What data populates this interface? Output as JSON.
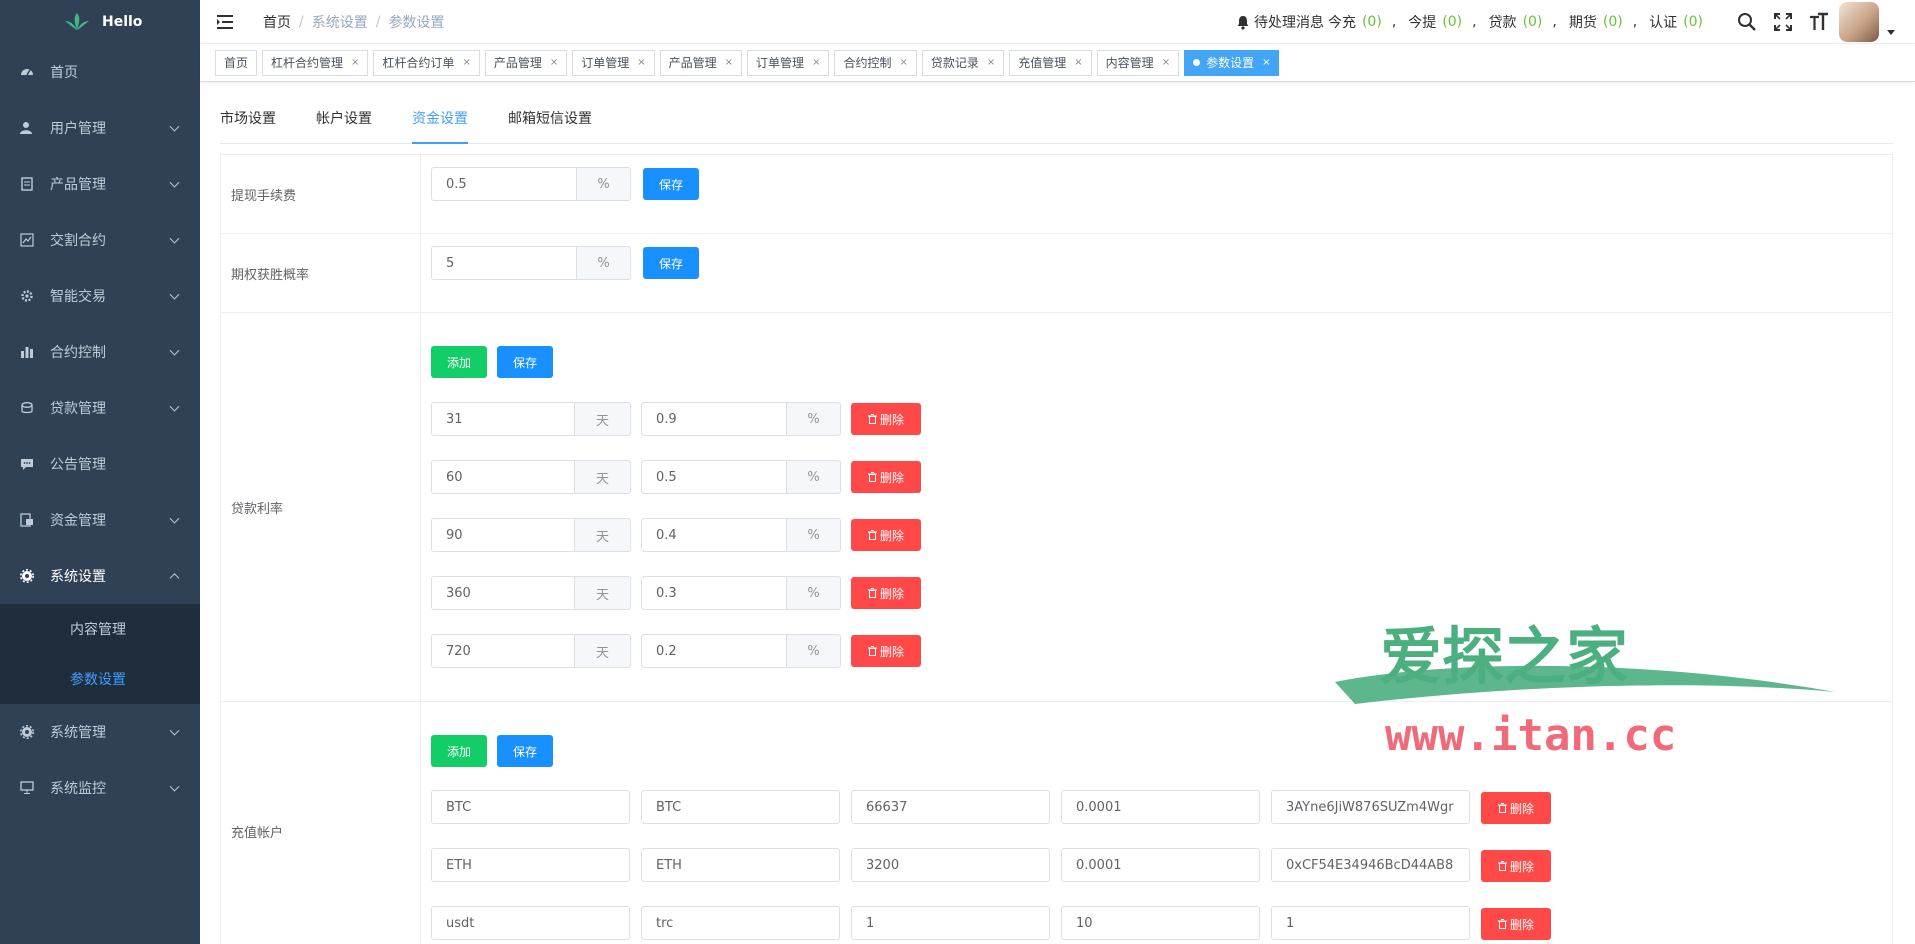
{
  "app": {
    "logo_text": "Hello"
  },
  "sidebar": {
    "items": [
      {
        "label": "首页",
        "icon": "dashboard-icon",
        "has_children": false
      },
      {
        "label": "用户管理",
        "icon": "user-icon",
        "has_children": true
      },
      {
        "label": "产品管理",
        "icon": "document-icon",
        "has_children": true
      },
      {
        "label": "交割合约",
        "icon": "chart-line-icon",
        "has_children": true
      },
      {
        "label": "智能交易",
        "icon": "gear-icon",
        "has_children": true
      },
      {
        "label": "合约控制",
        "icon": "bar-chart-icon",
        "has_children": true
      },
      {
        "label": "贷款管理",
        "icon": "money-icon",
        "has_children": true
      },
      {
        "label": "公告管理",
        "icon": "message-icon",
        "has_children": false
      },
      {
        "label": "资金管理",
        "icon": "wallet-icon",
        "has_children": true
      },
      {
        "label": "系统设置",
        "icon": "settings-icon",
        "has_children": true,
        "open": true
      }
    ],
    "submenu": [
      {
        "label": "内容管理",
        "active": false
      },
      {
        "label": "参数设置",
        "active": true
      }
    ],
    "bottom_items": [
      {
        "label": "系统管理",
        "icon": "settings-icon"
      },
      {
        "label": "系统监控",
        "icon": "monitor-icon"
      }
    ]
  },
  "navbar": {
    "breadcrumb": [
      "首页",
      "系统设置",
      "参数设置"
    ],
    "notice_label": "待处理消息",
    "counters": [
      {
        "label": "今充",
        "value": "(0)"
      },
      {
        "label": "今提",
        "value": "(0)"
      },
      {
        "label": "贷款",
        "value": "(0)"
      },
      {
        "label": "期货",
        "value": "(0)"
      },
      {
        "label": "认证",
        "value": "(0)"
      }
    ],
    "comma": ","
  },
  "tags": [
    {
      "label": "首页",
      "closable": false
    },
    {
      "label": "杠杆合约管理",
      "closable": true
    },
    {
      "label": "杠杆合约订单",
      "closable": true
    },
    {
      "label": "产品管理",
      "closable": true
    },
    {
      "label": "订单管理",
      "closable": true
    },
    {
      "label": "产品管理",
      "closable": true
    },
    {
      "label": "订单管理",
      "closable": true
    },
    {
      "label": "合约控制",
      "closable": true
    },
    {
      "label": "贷款记录",
      "closable": true
    },
    {
      "label": "充值管理",
      "closable": true
    },
    {
      "label": "内容管理",
      "closable": true
    },
    {
      "label": "参数设置",
      "closable": true,
      "active": true
    }
  ],
  "tag_close": "×",
  "tabs": [
    "市场设置",
    "帐户设置",
    "资金设置",
    "邮箱短信设置"
  ],
  "active_tab": 2,
  "settings": {
    "withdraw_fee": {
      "label": "提现手续费",
      "value": "0.5",
      "unit": "%",
      "save": "保存"
    },
    "option_win_rate": {
      "label": "期权获胜概率",
      "value": "5",
      "unit": "%",
      "save": "保存"
    },
    "loan_rate": {
      "label": "贷款利率",
      "add": "添加",
      "save": "保存",
      "day_unit": "天",
      "pct_unit": "%",
      "delete": "删除",
      "rows": [
        {
          "days": "31",
          "rate": "0.9"
        },
        {
          "days": "60",
          "rate": "0.5"
        },
        {
          "days": "90",
          "rate": "0.4"
        },
        {
          "days": "360",
          "rate": "0.3"
        },
        {
          "days": "720",
          "rate": "0.2"
        }
      ]
    },
    "recharge_accounts": {
      "label": "充值帐户",
      "add": "添加",
      "save": "保存",
      "delete": "删除",
      "rows": [
        {
          "name": "BTC",
          "chain": "BTC",
          "price": "66637",
          "min": "0.0001",
          "address": "3AYne6JiW876SUZm4Wgr"
        },
        {
          "name": "ETH",
          "chain": "ETH",
          "price": "3200",
          "min": "0.0001",
          "address": "0xCF54E34946BcD44AB8"
        },
        {
          "name": "usdt",
          "chain": "trc",
          "price": "1",
          "min": "10",
          "address": "1"
        }
      ]
    }
  },
  "watermark": {
    "title": "爱探之家",
    "url": "www.itan.cc"
  },
  "colors": {
    "sidebar_bg": "#304156",
    "primary": "#1890ff",
    "success": "#13ce66",
    "danger": "#ff4949",
    "active_link": "#409eff"
  }
}
